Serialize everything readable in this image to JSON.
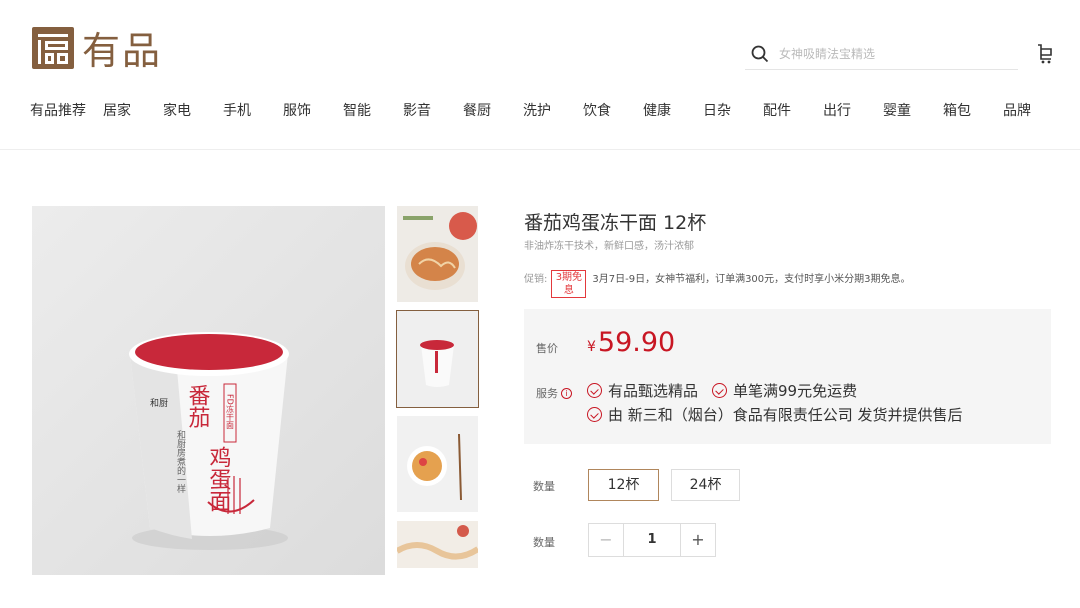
{
  "header": {
    "logo_text": "有品",
    "search_placeholder": "女神吸睛法宝精选"
  },
  "nav": {
    "items": [
      "有品推荐",
      "居家",
      "家电",
      "手机",
      "服饰",
      "智能",
      "影音",
      "餐厨",
      "洗护",
      "饮食",
      "健康",
      "日杂",
      "配件",
      "出行",
      "婴童",
      "箱包",
      "品牌"
    ]
  },
  "product": {
    "title": "番茄鸡蛋冻干面 12杯",
    "subtitle": "非油炸冻干技术，新鲜口感，汤汁浓郁",
    "promo": {
      "label": "促销:",
      "badge": "3期免息",
      "text": "3月7日-9日，女神节福利，订单满300元，支付时享小米分期3期免息。"
    },
    "price": {
      "label": "售价",
      "currency": "¥",
      "value": "59.90"
    },
    "service": {
      "label": "服务",
      "info_icon": "i",
      "items": [
        "有品甄选精品",
        "单笔满99元免运费",
        "由 新三和（烟台）食品有限责任公司 发货并提供售后"
      ]
    },
    "options": {
      "label": "数量",
      "choices": [
        "12杯",
        "24杯"
      ],
      "selected": "12杯"
    },
    "quantity": {
      "label": "数量",
      "value": "1",
      "minus": "−",
      "plus": "+"
    },
    "cup": {
      "brand": "和厨",
      "title_a": "番茄",
      "title_b": "鸡蛋面",
      "tag": "FD冻干面",
      "slogan": "和厨房煮的一样"
    }
  },
  "colors": {
    "brand": "#845f3f",
    "price": "#c81623",
    "promo": "#e3393c"
  }
}
